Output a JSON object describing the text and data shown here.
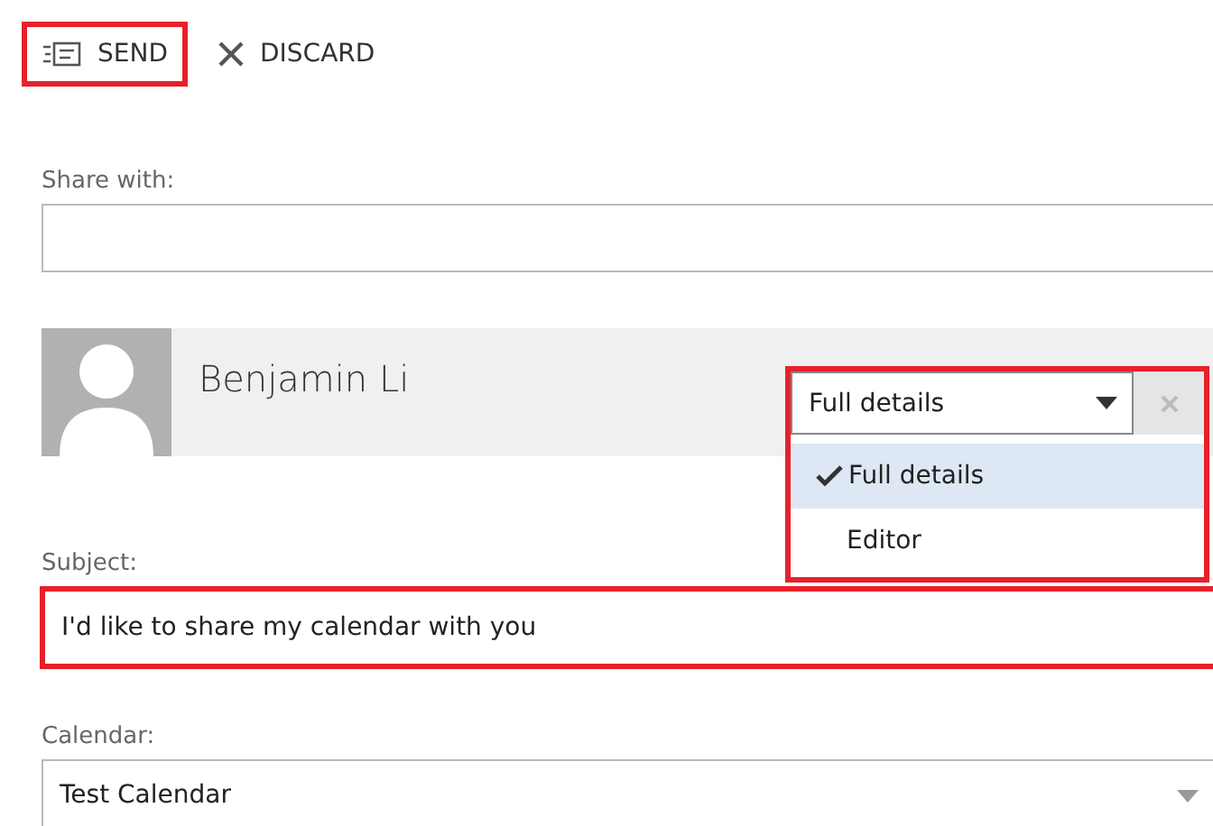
{
  "toolbar": [
    {
      "kind": "send",
      "label": "SEND",
      "highlighted": true
    },
    {
      "kind": "discard",
      "label": "DISCARD",
      "highlighted": false
    }
  ],
  "share_with": {
    "label": "Share with:"
  },
  "recipient": {
    "name": "Benjamin Li",
    "permission": "Full details",
    "highlighted": true,
    "expanded": true,
    "options": [
      {
        "label": "Full details",
        "selected": true
      },
      {
        "label": "Editor",
        "selected": false
      }
    ]
  },
  "subject": {
    "label": "Subject:",
    "value": "I'd like to share my calendar with you",
    "highlighted": true
  },
  "calendar": {
    "label": "Calendar:",
    "value": "Test Calendar"
  }
}
